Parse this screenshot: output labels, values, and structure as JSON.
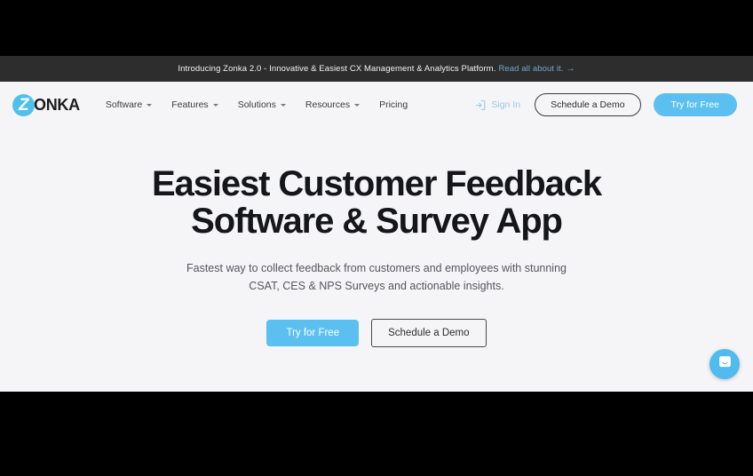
{
  "banner": {
    "text": "Introducing Zonka 2.0 - Innovative & Easiest CX Management & Analytics Platform.",
    "link_label": "Read all about it.",
    "arrow": "→"
  },
  "navbar": {
    "logo": {
      "mark_letter": "Z",
      "word": "ONKA"
    },
    "links": [
      {
        "label": "Software",
        "has_caret": true
      },
      {
        "label": "Features",
        "has_caret": true
      },
      {
        "label": "Solutions",
        "has_caret": true
      },
      {
        "label": "Resources",
        "has_caret": true
      },
      {
        "label": "Pricing",
        "has_caret": false
      }
    ],
    "sign_in_label": "Sign In",
    "sign_in_icon": "login-arrow-icon",
    "demo_label": "Schedule a Demo",
    "try_label": "Try for Free"
  },
  "hero": {
    "heading_line1": "Easiest Customer Feedback",
    "heading_line2": "Software & Survey App",
    "subheading_line1": "Fastest way to collect feedback from customers and employees with stunning",
    "subheading_line2": "CSAT, CES & NPS Surveys and actionable insights.",
    "primary_cta": "Try for Free",
    "secondary_cta": "Schedule a Demo"
  },
  "chat": {
    "icon": "chat-message-icon"
  },
  "colors": {
    "brand_blue": "#5bc0f0",
    "banner_bg": "#2d2d2d",
    "page_bg": "#f5f5f7",
    "banner_link": "#6ea8cc",
    "heading": "#15161a"
  }
}
